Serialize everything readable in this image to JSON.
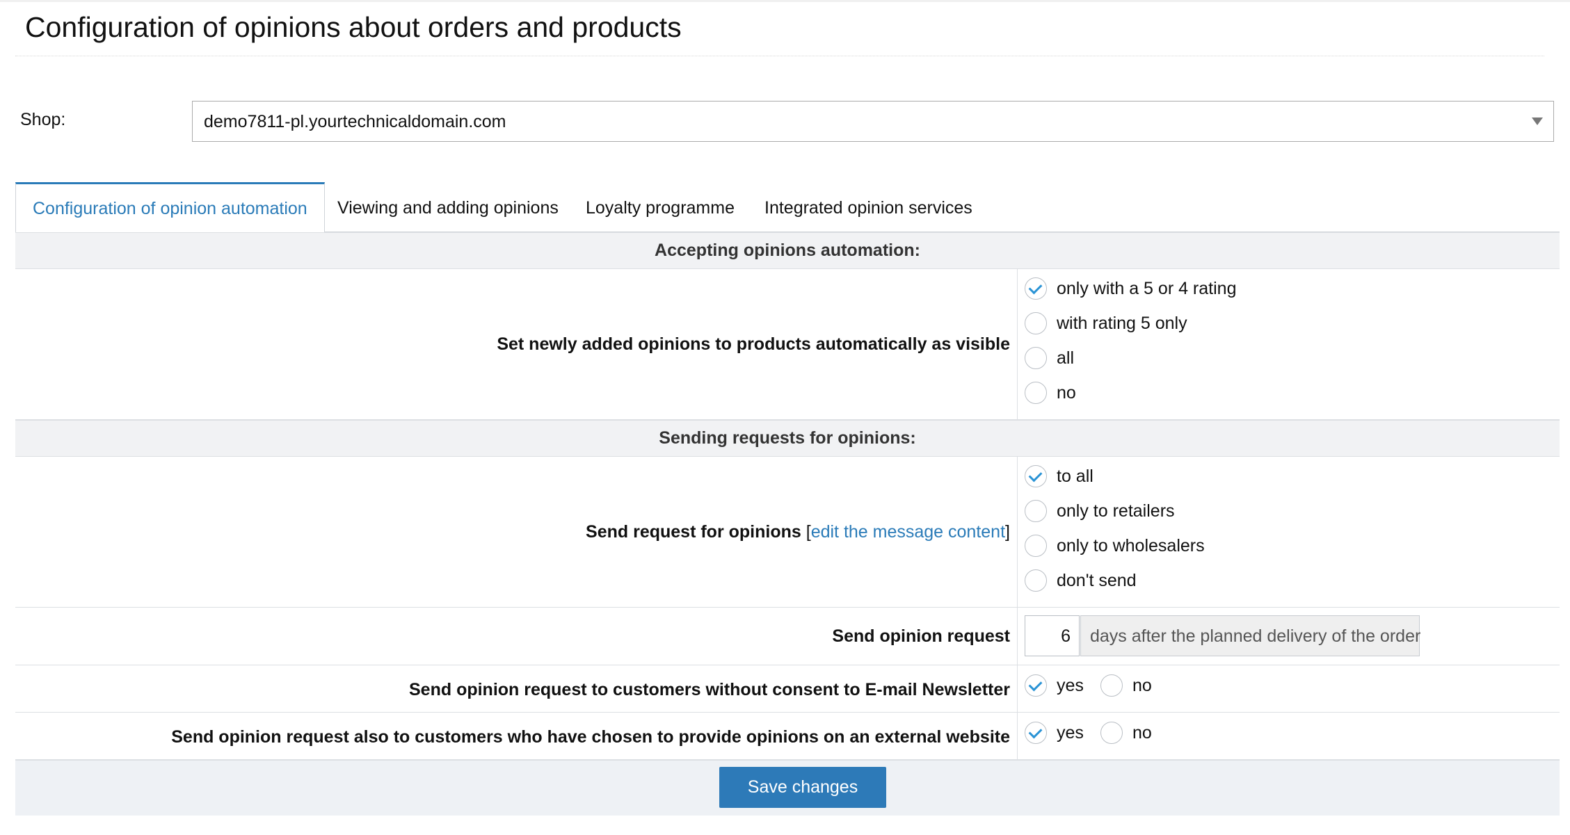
{
  "page": {
    "title": "Configuration of opinions about orders and products"
  },
  "shop": {
    "label": "Shop:",
    "selected": "demo7811-pl.yourtechnicaldomain.com"
  },
  "tabs": [
    {
      "label": "Configuration of opinion automation",
      "active": true
    },
    {
      "label": "Viewing and adding opinions",
      "active": false
    },
    {
      "label": "Loyalty programme",
      "active": false
    },
    {
      "label": "Integrated opinion services",
      "active": false
    }
  ],
  "sections": {
    "accepting": {
      "header": "Accepting opinions automation:",
      "visible_row": {
        "label": "Set newly added opinions to products automatically as visible",
        "options": [
          {
            "label": "only with a 5 or 4 rating",
            "checked": true
          },
          {
            "label": "with rating 5 only",
            "checked": false
          },
          {
            "label": "all",
            "checked": false
          },
          {
            "label": "no",
            "checked": false
          }
        ]
      }
    },
    "sending": {
      "header": "Sending requests for opinions:",
      "request_row": {
        "label": "Send request for opinions",
        "bracket_open": "[",
        "link": "edit the message content",
        "bracket_close": "]",
        "options": [
          {
            "label": "to all",
            "checked": true
          },
          {
            "label": "only to retailers",
            "checked": false
          },
          {
            "label": "only to wholesalers",
            "checked": false
          },
          {
            "label": "don't send",
            "checked": false
          }
        ]
      },
      "days_row": {
        "label": "Send opinion request",
        "days_value": "6",
        "days_suffix": "days after the planned delivery of the order"
      },
      "consent_row": {
        "label": "Send opinion request to customers without consent to E-mail Newsletter",
        "yes": "yes",
        "no": "no",
        "selected": "yes"
      },
      "external_row": {
        "label": "Send opinion request also to customers who have chosen to provide opinions on an external website",
        "yes": "yes",
        "no": "no",
        "selected": "yes"
      }
    }
  },
  "footer": {
    "save_label": "Save changes"
  },
  "colors": {
    "accent": "#2a7bb8",
    "check": "#2a93d5",
    "section_bg": "#f1f2f4",
    "footer_bg": "#eef1f5"
  }
}
